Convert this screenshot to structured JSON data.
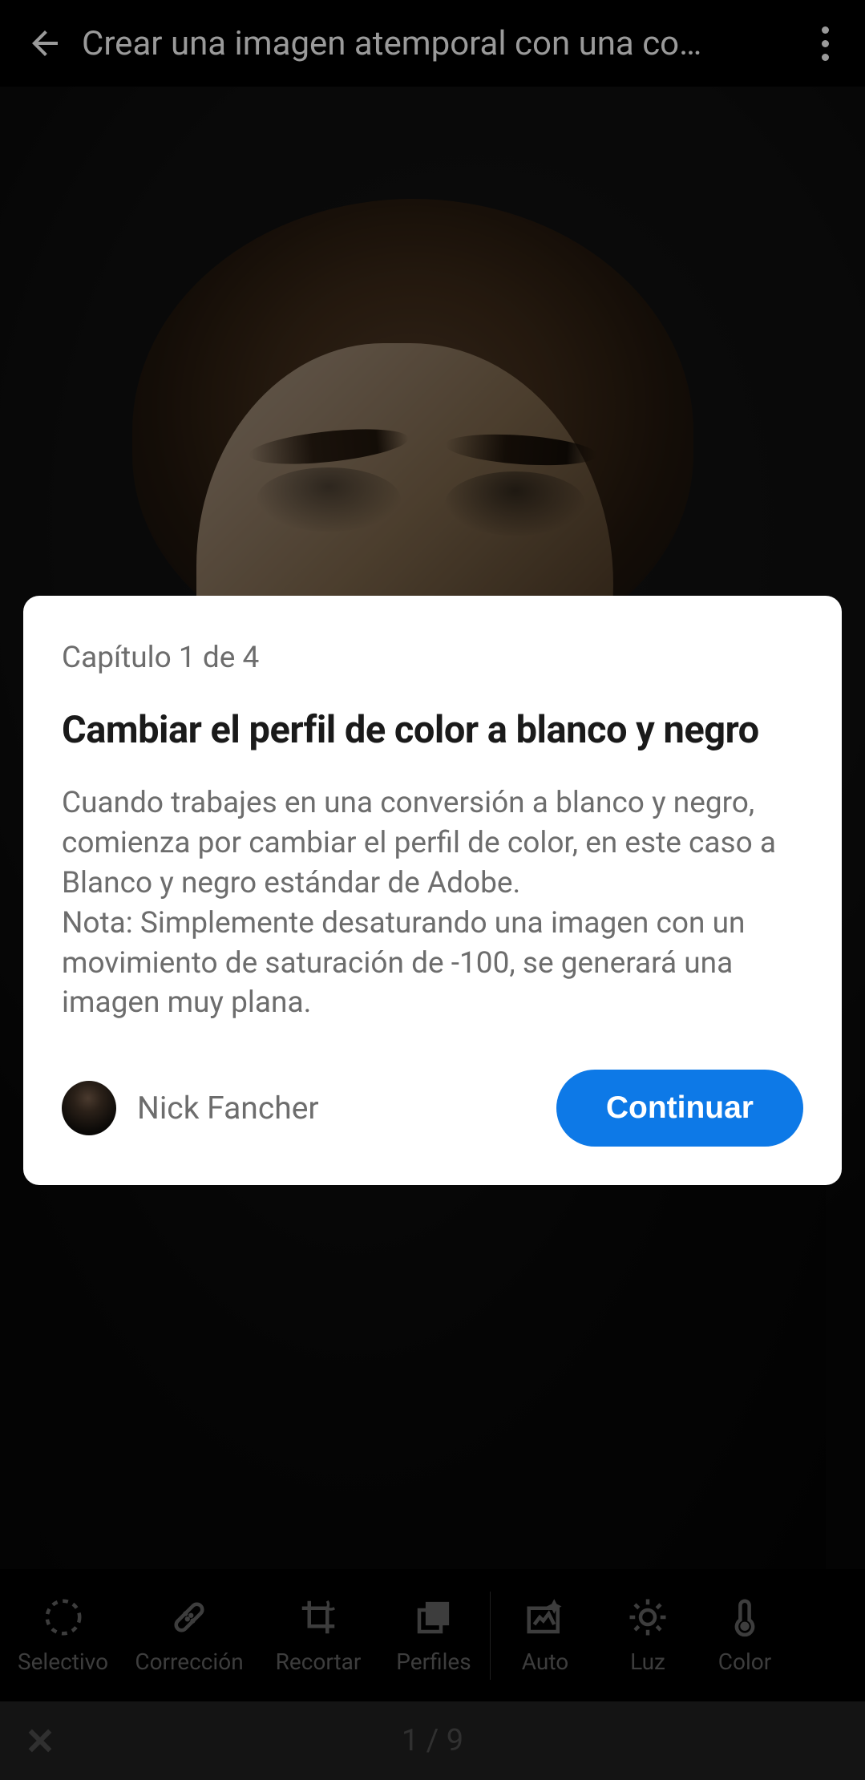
{
  "header": {
    "title": "Crear una imagen atemporal con una co…"
  },
  "card": {
    "chapter": "Capítulo 1 de 4",
    "title": "Cambiar el perfil de color a blanco y negro",
    "body": "Cuando trabajes en una conversión a blanco y negro, comienza por cambiar el perfil de color, en este caso a Blanco y negro estándar de Adobe.\nNota: Simplemente desaturando una imagen con un movimiento de saturación de -100, se generará una imagen muy plana.",
    "author": "Nick Fancher",
    "continue": "Continuar"
  },
  "toolbar": {
    "items": [
      {
        "label": "Selectivo"
      },
      {
        "label": "Corrección"
      },
      {
        "label": "Recortar"
      },
      {
        "label": "Perfiles"
      },
      {
        "label": "Auto"
      },
      {
        "label": "Luz"
      },
      {
        "label": "Color"
      }
    ]
  },
  "bottom": {
    "pager": "1 / 9"
  }
}
